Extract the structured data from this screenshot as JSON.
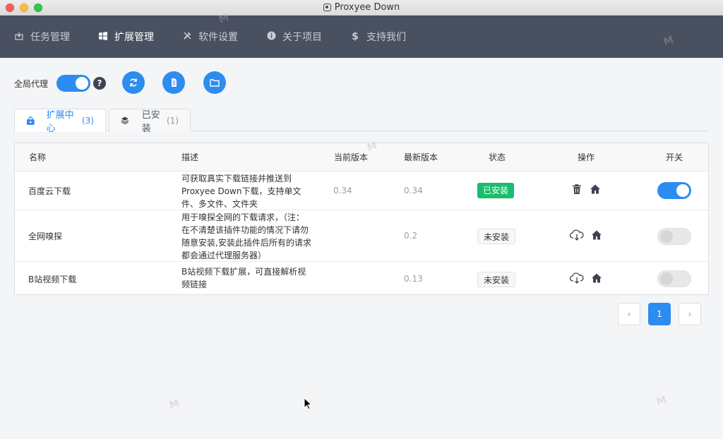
{
  "window": {
    "title": "Proxyee Down"
  },
  "nav": {
    "items": [
      {
        "label": "任务管理",
        "icon": "download-box-icon",
        "active": false
      },
      {
        "label": "扩展管理",
        "icon": "windows-icon",
        "active": true
      },
      {
        "label": "软件设置",
        "icon": "tools-icon",
        "active": false
      },
      {
        "label": "关于项目",
        "icon": "info-icon",
        "active": false
      },
      {
        "label": "支持我们",
        "icon": "dollar-icon",
        "active": false
      }
    ]
  },
  "toolbar": {
    "global_proxy_label": "全局代理",
    "global_proxy_on": true,
    "help_label": "?",
    "buttons": [
      "refresh-icon",
      "clipboard-icon",
      "folder-icon"
    ]
  },
  "tabs": [
    {
      "label": "扩展中心",
      "count": "(3)",
      "icon": "shop-bag-icon",
      "active": true
    },
    {
      "label": "已安装",
      "count": "(1)",
      "icon": "layers-icon",
      "active": false
    }
  ],
  "table": {
    "headers": {
      "name": "名称",
      "desc": "描述",
      "current_version": "当前版本",
      "latest_version": "最新版本",
      "status": "状态",
      "actions": "操作",
      "switch": "开关"
    },
    "rows": [
      {
        "name": "百度云下载",
        "desc": "可获取真实下载链接并推送到Proxyee Down下载，支持单文件、多文件、文件夹",
        "current_version": "0.34",
        "latest_version": "0.34",
        "status": "已安装",
        "status_type": "installed",
        "actions": [
          "trash-icon",
          "home-icon"
        ],
        "enabled": true
      },
      {
        "name": "全网嗅探",
        "desc": "用于嗅探全网的下载请求，（注：在不清楚该插件功能的情况下请勿随意安装,安装此插件后所有的请求都会通过代理服务器）",
        "current_version": "",
        "latest_version": "0.2",
        "status": "未安装",
        "status_type": "not",
        "actions": [
          "cloud-download-icon",
          "home-icon"
        ],
        "enabled": false
      },
      {
        "name": "B站视频下载",
        "desc": "B站视频下载扩展，可直接解析视频链接",
        "current_version": "",
        "latest_version": "0.13",
        "status": "未安装",
        "status_type": "not",
        "actions": [
          "cloud-download-icon",
          "home-icon"
        ],
        "enabled": false
      }
    ]
  },
  "pagination": {
    "prev": "‹",
    "current": "1",
    "next": "›"
  },
  "colors": {
    "primary": "#2d8cf0",
    "nav_bg": "#495060",
    "success": "#19be6b"
  }
}
